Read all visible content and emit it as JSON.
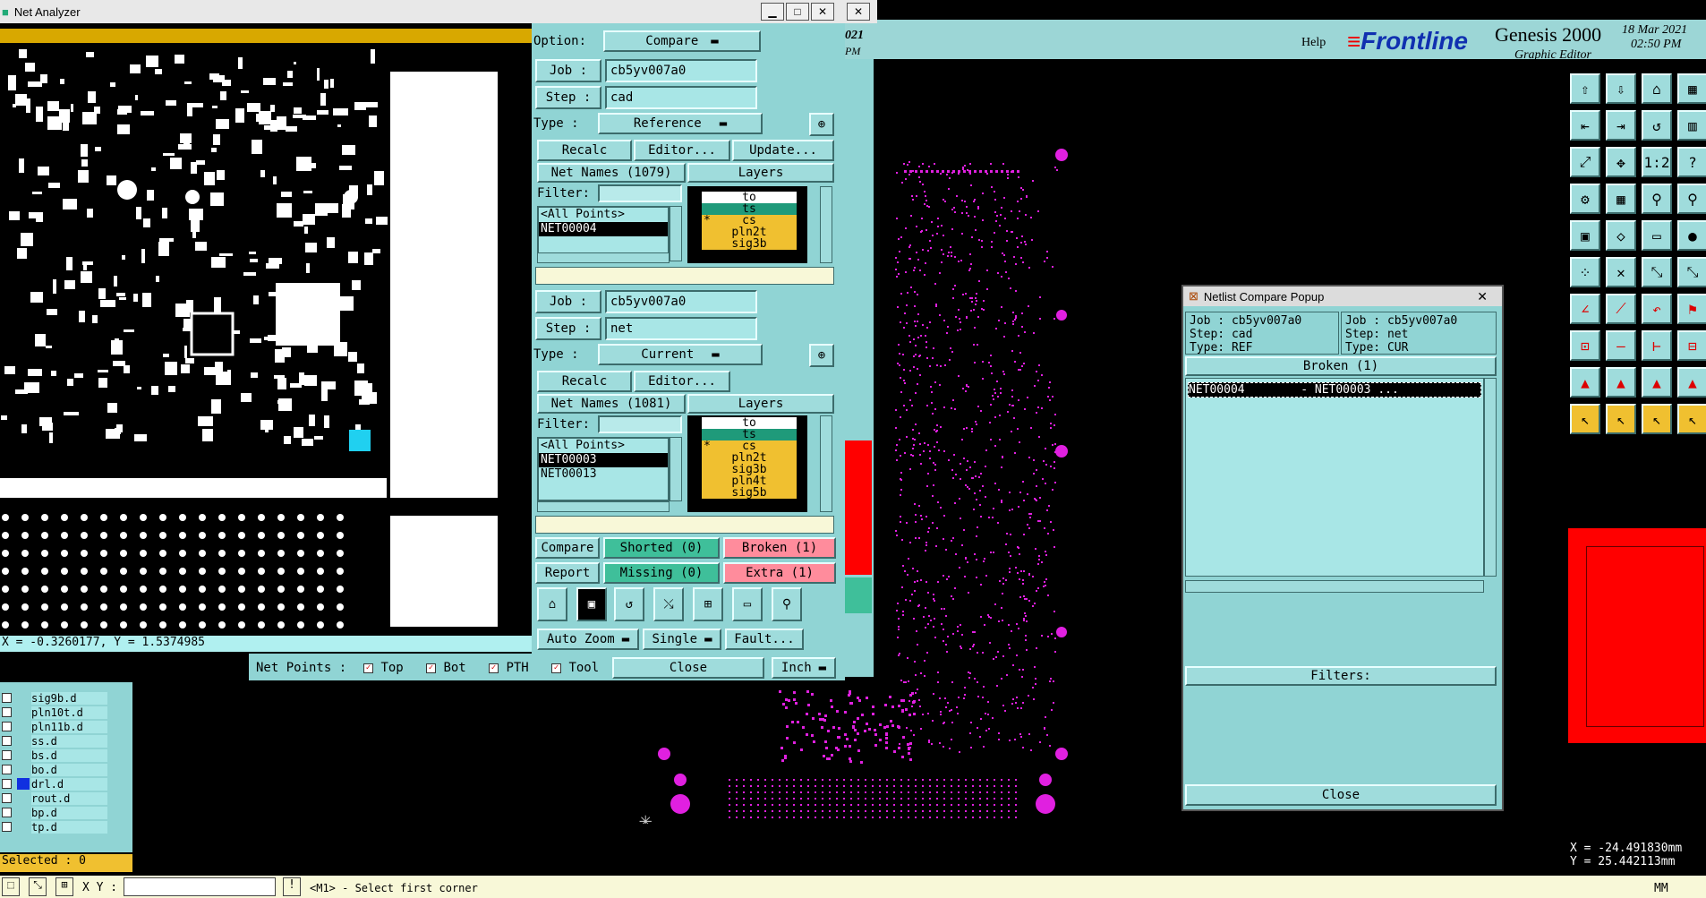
{
  "net_analyzer": {
    "title": "Net Analyzer",
    "coords": "X = -0.3260177, Y = 1.5374985",
    "option_label": "Option:",
    "option_value": "Compare",
    "ref": {
      "job_label": "Job  :",
      "job_value": "cb5yv007a0",
      "step_label": "Step  :",
      "step_value": "cad",
      "type_label": "Type  :",
      "type_value": "Reference",
      "recalc": "Recalc",
      "editor": "Editor...",
      "update": "Update...",
      "net_names_header": "Net Names (1079)",
      "layers_header": "Layers",
      "filter_label": "Filter:",
      "nets": [
        "<All Points>",
        "NET00004"
      ],
      "layers": [
        {
          "name": "to",
          "color": "#ffffff",
          "mark": ""
        },
        {
          "name": "ts",
          "color": "#1f9a7a",
          "mark": ""
        },
        {
          "name": "cs",
          "color": "#f0c030",
          "mark": "*"
        },
        {
          "name": "pln2t",
          "color": "#f0c030",
          "mark": ""
        },
        {
          "name": "sig3b",
          "color": "#f0c030",
          "mark": ""
        }
      ]
    },
    "cur": {
      "job_label": "Job  :",
      "job_value": "cb5yv007a0",
      "step_label": "Step  :",
      "step_value": "net",
      "type_label": "Type  :",
      "type_value": "Current",
      "recalc": "Recalc",
      "editor": "Editor...",
      "net_names_header": "Net Names (1081)",
      "layers_header": "Layers",
      "filter_label": "Filter:",
      "nets": [
        "<All Points>",
        "NET00003",
        "NET00013"
      ],
      "layers": [
        {
          "name": "to",
          "color": "#ffffff",
          "mark": ""
        },
        {
          "name": "ts",
          "color": "#1f9a7a",
          "mark": ""
        },
        {
          "name": "cs",
          "color": "#f0c030",
          "mark": "*"
        },
        {
          "name": "pln2t",
          "color": "#f0c030",
          "mark": ""
        },
        {
          "name": "sig3b",
          "color": "#f0c030",
          "mark": ""
        },
        {
          "name": "pln4t",
          "color": "#f0c030",
          "mark": ""
        },
        {
          "name": "sig5b",
          "color": "#f0c030",
          "mark": ""
        }
      ]
    },
    "compare": "Compare",
    "report": "Report",
    "shorted": "Shorted (0)",
    "missing": "Missing (0)",
    "broken": "Broken  (1)",
    "extra": "Extra  (1)",
    "auto_zoom": "Auto Zoom",
    "single": "Single",
    "fault": "Fault...",
    "net_points_label": "Net Points :",
    "checks": [
      "Top",
      "Bot",
      "PTH",
      "Tool"
    ],
    "close": "Close",
    "units": "Inch"
  },
  "genesis": {
    "help": "Help",
    "brand": "Frontline",
    "product": "Genesis 2000",
    "subtitle": "Graphic Editor",
    "date": "18 Mar 2021",
    "time": "02:50 PM",
    "behind_date": "021",
    "behind_time": "PM",
    "coords_x": "X = -24.491830mm",
    "coords_y": "Y = 25.442113mm",
    "status_units": "MM",
    "xy_label": "X Y :",
    "hint": "<M1> - Select first corner",
    "selected": "Selected : 0"
  },
  "layers_list": [
    "sig9b.d",
    "pln10t.d",
    "pln11b.d",
    "ss.d",
    "bs.d",
    "bo.d",
    "drl.d",
    "rout.d",
    "bp.d",
    "tp.d"
  ],
  "netlist_popup": {
    "title": "Netlist Compare Popup",
    "left": {
      "job": "Job  : cb5yv007a0",
      "step": "Step: cad",
      "type": "Type: REF"
    },
    "right": {
      "job": "Job  : cb5yv007a0",
      "step": "Step: net",
      "type": "Type: CUR"
    },
    "section": "Broken (1)",
    "row": "NET00004        - NET00003 ...",
    "filters": "Filters:",
    "close": "Close"
  },
  "colors": {
    "panel": "#90d4d4",
    "accent_pink": "#ff8c9c",
    "accent_green": "#3fbf9a",
    "magenta": "#e020e0",
    "red": "#ff0000",
    "yellow": "#f0c030"
  }
}
